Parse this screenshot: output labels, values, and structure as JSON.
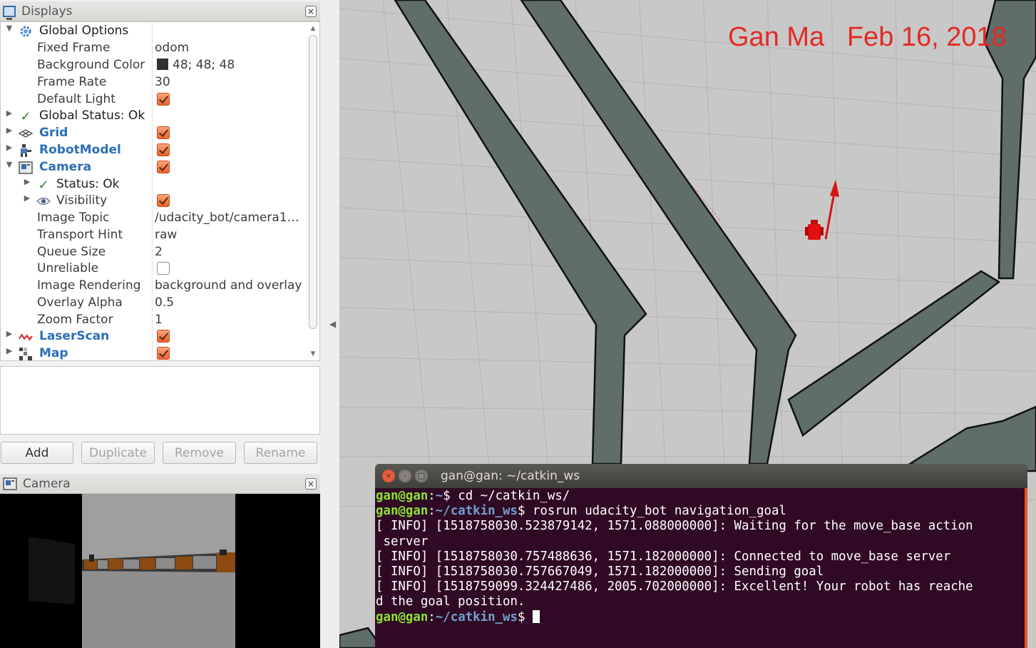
{
  "displays_panel": {
    "title": "Displays",
    "close_glyph": "×",
    "items": [
      {
        "label": "Global Options",
        "expand": "▼",
        "icon": "gear-icon"
      },
      {
        "label": "Fixed Frame",
        "value": "odom"
      },
      {
        "label": "Background Color",
        "value": "48; 48; 48"
      },
      {
        "label": "Frame Rate",
        "value": "30"
      },
      {
        "label": "Default Light",
        "checked": true
      },
      {
        "label": "Global Status: Ok",
        "expand": "▶",
        "icon": "check-icon"
      },
      {
        "label": "Grid",
        "expand": "▶",
        "icon": "grid-icon",
        "checked": true
      },
      {
        "label": "RobotModel",
        "expand": "▶",
        "icon": "robot-icon",
        "checked": true
      },
      {
        "label": "Camera",
        "expand": "▼",
        "icon": "camera-icon",
        "checked": true
      },
      {
        "label": "Status: Ok",
        "expand": "▶",
        "icon": "check-icon"
      },
      {
        "label": "Visibility",
        "expand": "▶",
        "icon": "eye-icon",
        "checked": true
      },
      {
        "label": "Image Topic",
        "value": "/udacity_bot/camera1…"
      },
      {
        "label": "Transport Hint",
        "value": "raw"
      },
      {
        "label": "Queue Size",
        "value": "2"
      },
      {
        "label": "Unreliable",
        "checked": false
      },
      {
        "label": "Image Rendering",
        "value": "background and overlay"
      },
      {
        "label": "Overlay Alpha",
        "value": "0.5"
      },
      {
        "label": "Zoom Factor",
        "value": "1"
      },
      {
        "label": "LaserScan",
        "expand": "▶",
        "icon": "laserscan-icon",
        "checked": true
      },
      {
        "label": "Map",
        "expand": "▶",
        "icon": "map-icon",
        "checked": true
      }
    ],
    "check_glyph": "✓"
  },
  "buttons": {
    "add": "Add",
    "duplicate": "Duplicate",
    "remove": "Remove",
    "rename": "Rename"
  },
  "camera_panel": {
    "title": "Camera",
    "close_glyph": "×"
  },
  "splitter": {
    "arrow_glyph": "◀"
  },
  "view3d": {
    "watermark": "Gan Ma   Feb 16, 2018",
    "robot_color": "#e01010",
    "wall_color": "#5f6d6b"
  },
  "terminal": {
    "title": "gan@gan: ~/catkin_ws",
    "buttons": {
      "close": "×",
      "minimize": "–",
      "maximize": "□"
    },
    "lines": [
      {
        "user": "gan@gan",
        "path": "~",
        "cmd": " cd ~/catkin_ws/"
      },
      {
        "user": "gan@gan",
        "path": "~/catkin_ws",
        "cmd": " rosrun udacity_bot navigation_goal"
      },
      {
        "text": "[ INFO] [1518758030.523879142, 1571.088000000]: Waiting for the move_base action"
      },
      {
        "text": " server"
      },
      {
        "text": "[ INFO] [1518758030.757488636, 1571.182000000]: Connected to move_base server"
      },
      {
        "text": "[ INFO] [1518758030.757667049, 1571.182000000]: Sending goal"
      },
      {
        "text": "[ INFO] [1518759099.324427486, 2005.702000000]: Excellent! Your robot has reache"
      },
      {
        "text": "d the goal position."
      },
      {
        "user": "gan@gan",
        "path": "~/catkin_ws",
        "cmd": " "
      }
    ]
  }
}
